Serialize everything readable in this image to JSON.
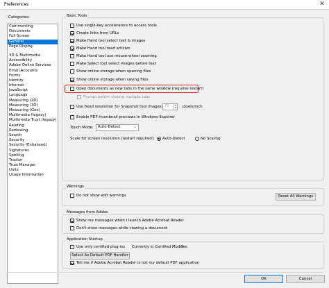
{
  "window": {
    "title": "Preferences"
  },
  "categories": {
    "label": "Categories:",
    "top": [
      "Commenting",
      "Documents",
      "Full Screen",
      "General",
      "Page Display"
    ],
    "rest": [
      "3D & Multimedia",
      "Accessibility",
      "Adobe Online Services",
      "Email Accounts",
      "Forms",
      "Identity",
      "Internet",
      "JavaScript",
      "Language",
      "Measuring (2D)",
      "Measuring (3D)",
      "Measuring (Geo)",
      "Multimedia (legacy)",
      "Multimedia Trust (legacy)",
      "Reading",
      "Reviewing",
      "Search",
      "Security",
      "Security (Enhanced)",
      "Signatures",
      "Spelling",
      "Tracker",
      "Trust Manager",
      "Units",
      "Usage Information"
    ],
    "selected": "General"
  },
  "basic_tools": {
    "label": "Basic Tools",
    "options": [
      "Use single-key accelerators to access tools",
      "Create links from URLs",
      "Make Hand tool select text & images",
      "Make Hand tool read articles",
      "Make Hand tool use mouse-wheel zooming",
      "Make Select tool select images before text",
      "Show online storage when opening files",
      "Show online storage when saving files",
      "Open documents as new tabs in the same window (requires restart)",
      "Prompt before closing multiple tabs",
      "Use fixed resolution for Snapshot tool images:",
      "Enable PDF thumbnail previews in Windows Explorer"
    ],
    "snapshot_value": "72",
    "snapshot_unit": "pixels/inch",
    "touch_mode_label": "Touch Mode:",
    "touch_mode_value": "Auto-Detect",
    "scale_label": "Scale for screen resolution (restart required):",
    "scale_auto": "Auto-Detect",
    "scale_none": "No Scaling"
  },
  "warnings": {
    "label": "Warnings",
    "do_not_show": "Do not show edit warnings",
    "reset_button": "Reset All Warnings"
  },
  "messages": {
    "label": "Messages from Adobe",
    "show_launch": "Show me messages when I launch Adobe Acrobat Reader",
    "dont_show_viewing": "Don't show messages while viewing a document"
  },
  "startup": {
    "label": "Application Startup",
    "certified_only": "Use only certified plug-ins",
    "certified_mode_label": "Currently in Certified Mode:",
    "certified_mode_value": "Yes",
    "default_handler_button": "Select As Default PDF Handler",
    "tell_me": "Tell me if Adobe Acrobat Reader is not my default PDF application"
  },
  "footer": {
    "ok": "OK",
    "cancel": "Cancel"
  },
  "colors": {
    "selection": "#0078d7",
    "highlight": "#d11f1f"
  }
}
